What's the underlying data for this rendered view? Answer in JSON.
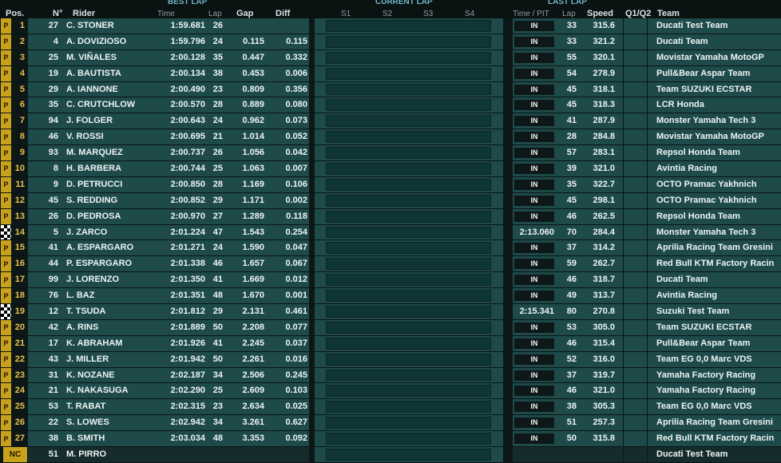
{
  "header": {
    "pos": "Pos.",
    "no": "N°",
    "rider": "Rider",
    "best_lap": "BEST LAP",
    "time": "Time",
    "lap": "Lap",
    "gap": "Gap",
    "diff": "Diff",
    "current_lap": "CURRENT LAP",
    "s1": "S1",
    "s2": "S2",
    "s3": "S3",
    "s4": "S4",
    "last_lap": "LAST LAP",
    "time_pit": "Time / PIT",
    "last_lap_col": "Lap",
    "speed": "Speed",
    "q": "Q1/Q2",
    "team": "Team"
  },
  "rows": [
    {
      "flag": "P",
      "pos": "1",
      "num": "27",
      "rider": "C. STONER",
      "time": "1:59.681",
      "lap": "26",
      "gap": "",
      "diff": "",
      "pit": "IN",
      "llap": "33",
      "speed": "315.6",
      "team": "Ducati Test Team"
    },
    {
      "flag": "P",
      "pos": "2",
      "num": "4",
      "rider": "A. DOVIZIOSO",
      "time": "1:59.796",
      "lap": "24",
      "gap": "0.115",
      "diff": "0.115",
      "pit": "IN",
      "llap": "33",
      "speed": "321.2",
      "team": "Ducati Team"
    },
    {
      "flag": "P",
      "pos": "3",
      "num": "25",
      "rider": "M. VIÑALES",
      "time": "2:00.128",
      "lap": "35",
      "gap": "0.447",
      "diff": "0.332",
      "pit": "IN",
      "llap": "55",
      "speed": "320.1",
      "team": "Movistar Yamaha MotoGP"
    },
    {
      "flag": "P",
      "pos": "4",
      "num": "19",
      "rider": "A. BAUTISTA",
      "time": "2:00.134",
      "lap": "38",
      "gap": "0.453",
      "diff": "0.006",
      "pit": "IN",
      "llap": "54",
      "speed": "278.9",
      "team": "Pull&Bear Aspar Team"
    },
    {
      "flag": "P",
      "pos": "5",
      "num": "29",
      "rider": "A. IANNONE",
      "time": "2:00.490",
      "lap": "23",
      "gap": "0.809",
      "diff": "0.356",
      "pit": "IN",
      "llap": "45",
      "speed": "318.1",
      "team": "Team SUZUKI ECSTAR"
    },
    {
      "flag": "P",
      "pos": "6",
      "num": "35",
      "rider": "C. CRUTCHLOW",
      "time": "2:00.570",
      "lap": "28",
      "gap": "0.889",
      "diff": "0.080",
      "pit": "IN",
      "llap": "45",
      "speed": "318.3",
      "team": "LCR Honda"
    },
    {
      "flag": "P",
      "pos": "7",
      "num": "94",
      "rider": "J. FOLGER",
      "time": "2:00.643",
      "lap": "24",
      "gap": "0.962",
      "diff": "0.073",
      "pit": "IN",
      "llap": "41",
      "speed": "287.9",
      "team": "Monster Yamaha Tech 3"
    },
    {
      "flag": "P",
      "pos": "8",
      "num": "46",
      "rider": "V. ROSSI",
      "time": "2:00.695",
      "lap": "21",
      "gap": "1.014",
      "diff": "0.052",
      "pit": "IN",
      "llap": "28",
      "speed": "284.8",
      "team": "Movistar Yamaha MotoGP"
    },
    {
      "flag": "P",
      "pos": "9",
      "num": "93",
      "rider": "M. MARQUEZ",
      "time": "2:00.737",
      "lap": "26",
      "gap": "1.056",
      "diff": "0.042",
      "pit": "IN",
      "llap": "57",
      "speed": "283.1",
      "team": "Repsol Honda Team"
    },
    {
      "flag": "P",
      "pos": "10",
      "num": "8",
      "rider": "H. BARBERA",
      "time": "2:00.744",
      "lap": "25",
      "gap": "1.063",
      "diff": "0.007",
      "pit": "IN",
      "llap": "39",
      "speed": "321.0",
      "team": "Avintia Racing"
    },
    {
      "flag": "P",
      "pos": "11",
      "num": "9",
      "rider": "D. PETRUCCI",
      "time": "2:00.850",
      "lap": "28",
      "gap": "1.169",
      "diff": "0.106",
      "pit": "IN",
      "llap": "35",
      "speed": "322.7",
      "team": "OCTO Pramac Yakhnich"
    },
    {
      "flag": "P",
      "pos": "12",
      "num": "45",
      "rider": "S. REDDING",
      "time": "2:00.852",
      "lap": "29",
      "gap": "1.171",
      "diff": "0.002",
      "pit": "IN",
      "llap": "45",
      "speed": "298.1",
      "team": "OCTO Pramac Yakhnich"
    },
    {
      "flag": "P",
      "pos": "13",
      "num": "26",
      "rider": "D. PEDROSA",
      "time": "2:00.970",
      "lap": "27",
      "gap": "1.289",
      "diff": "0.118",
      "pit": "IN",
      "llap": "46",
      "speed": "262.5",
      "team": "Repsol Honda Team"
    },
    {
      "flag": "CHK",
      "pos": "14",
      "num": "5",
      "rider": "J. ZARCO",
      "time": "2:01.224",
      "lap": "47",
      "gap": "1.543",
      "diff": "0.254",
      "pit": "2:13.060",
      "llap": "70",
      "speed": "284.4",
      "team": "Monster Yamaha Tech 3"
    },
    {
      "flag": "P",
      "pos": "15",
      "num": "41",
      "rider": "A. ESPARGARO",
      "time": "2:01.271",
      "lap": "24",
      "gap": "1.590",
      "diff": "0.047",
      "pit": "IN",
      "llap": "37",
      "speed": "314.2",
      "team": "Aprilia Racing Team Gresini"
    },
    {
      "flag": "P",
      "pos": "16",
      "num": "44",
      "rider": "P. ESPARGARO",
      "time": "2:01.338",
      "lap": "46",
      "gap": "1.657",
      "diff": "0.067",
      "pit": "IN",
      "llap": "59",
      "speed": "262.7",
      "team": "Red Bull KTM Factory Racin"
    },
    {
      "flag": "P",
      "pos": "17",
      "num": "99",
      "rider": "J. LORENZO",
      "time": "2:01.350",
      "lap": "41",
      "gap": "1.669",
      "diff": "0.012",
      "pit": "IN",
      "llap": "46",
      "speed": "318.7",
      "team": "Ducati Team"
    },
    {
      "flag": "P",
      "pos": "18",
      "num": "76",
      "rider": "L. BAZ",
      "time": "2:01.351",
      "lap": "48",
      "gap": "1.670",
      "diff": "0.001",
      "pit": "IN",
      "llap": "49",
      "speed": "313.7",
      "team": "Avintia Racing"
    },
    {
      "flag": "CHK",
      "pos": "19",
      "num": "12",
      "rider": "T. TSUDA",
      "time": "2:01.812",
      "lap": "29",
      "gap": "2.131",
      "diff": "0.461",
      "pit": "2:15.341",
      "llap": "80",
      "speed": "270.8",
      "team": "Suzuki Test Team"
    },
    {
      "flag": "P",
      "pos": "20",
      "num": "42",
      "rider": "A. RINS",
      "time": "2:01.889",
      "lap": "50",
      "gap": "2.208",
      "diff": "0.077",
      "pit": "IN",
      "llap": "53",
      "speed": "305.0",
      "team": "Team SUZUKI ECSTAR"
    },
    {
      "flag": "P",
      "pos": "21",
      "num": "17",
      "rider": "K. ABRAHAM",
      "time": "2:01.926",
      "lap": "41",
      "gap": "2.245",
      "diff": "0.037",
      "pit": "IN",
      "llap": "46",
      "speed": "315.4",
      "team": "Pull&Bear Aspar Team"
    },
    {
      "flag": "P",
      "pos": "22",
      "num": "43",
      "rider": "J. MILLER",
      "time": "2:01.942",
      "lap": "50",
      "gap": "2.261",
      "diff": "0.016",
      "pit": "IN",
      "llap": "52",
      "speed": "316.0",
      "team": "Team EG 0,0 Marc VDS"
    },
    {
      "flag": "P",
      "pos": "23",
      "num": "31",
      "rider": "K. NOZANE",
      "time": "2:02.187",
      "lap": "34",
      "gap": "2.506",
      "diff": "0.245",
      "pit": "IN",
      "llap": "37",
      "speed": "319.7",
      "team": "Yamaha Factory Racing"
    },
    {
      "flag": "P",
      "pos": "24",
      "num": "21",
      "rider": "K. NAKASUGA",
      "time": "2:02.290",
      "lap": "25",
      "gap": "2.609",
      "diff": "0.103",
      "pit": "IN",
      "llap": "46",
      "speed": "321.0",
      "team": "Yamaha Factory Racing"
    },
    {
      "flag": "P",
      "pos": "25",
      "num": "53",
      "rider": "T. RABAT",
      "time": "2:02.315",
      "lap": "23",
      "gap": "2.634",
      "diff": "0.025",
      "pit": "IN",
      "llap": "38",
      "speed": "305.3",
      "team": "Team EG 0,0 Marc VDS"
    },
    {
      "flag": "P",
      "pos": "26",
      "num": "22",
      "rider": "S. LOWES",
      "time": "2:02.942",
      "lap": "34",
      "gap": "3.261",
      "diff": "0.627",
      "pit": "IN",
      "llap": "51",
      "speed": "257.3",
      "team": "Aprilia Racing Team Gresini"
    },
    {
      "flag": "P",
      "pos": "27",
      "num": "38",
      "rider": "B. SMITH",
      "time": "2:03.034",
      "lap": "48",
      "gap": "3.353",
      "diff": "0.092",
      "pit": "IN",
      "llap": "50",
      "speed": "315.8",
      "team": "Red Bull KTM Factory Racin"
    },
    {
      "flag": "NC",
      "pos": "",
      "num": "51",
      "rider": "M. PIRRO",
      "time": "",
      "lap": "",
      "gap": "",
      "diff": "",
      "pit": "",
      "llap": "",
      "speed": "",
      "team": "Ducati Test Team"
    }
  ]
}
